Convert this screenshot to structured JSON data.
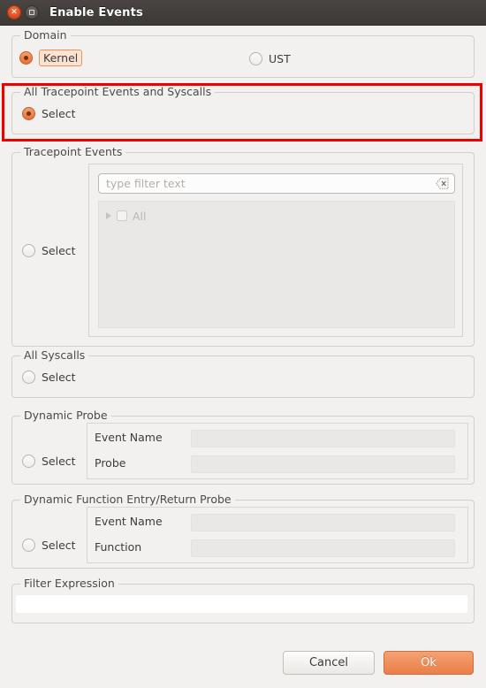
{
  "window": {
    "title": "Enable Events",
    "close_icon": "close-icon",
    "maximize_icon": "maximize-icon"
  },
  "colors": {
    "accent_orange": "#e8703a",
    "ok_button": "#ef8f5c",
    "highlight_red": "#ee0000",
    "window_bg": "#f2f1f0",
    "titlebar": "#3c3835"
  },
  "domain": {
    "legend": "Domain",
    "options": [
      {
        "label": "Kernel",
        "selected": true,
        "focused": true
      },
      {
        "label": "UST",
        "selected": false,
        "focused": false
      }
    ]
  },
  "all_tracepoints": {
    "legend": "All Tracepoint Events and Syscalls",
    "select_label": "Select",
    "selected": true,
    "highlighted": true
  },
  "tracepoint_events": {
    "legend": "Tracepoint Events",
    "select_label": "Select",
    "selected": false,
    "filter": {
      "placeholder": "type filter text",
      "value": "",
      "clear_icon": "clear-icon"
    },
    "tree": [
      {
        "label": "All",
        "checked": false,
        "expanded": false,
        "disabled": true,
        "expander_icon": "chevron-right-icon"
      }
    ]
  },
  "all_syscalls": {
    "legend": "All Syscalls",
    "select_label": "Select",
    "selected": false
  },
  "dynamic_probe": {
    "legend": "Dynamic Probe",
    "select_label": "Select",
    "selected": false,
    "fields": [
      {
        "label": "Event Name",
        "value": "",
        "disabled": true
      },
      {
        "label": "Probe",
        "value": "",
        "disabled": true
      }
    ]
  },
  "dynamic_function_probe": {
    "legend": "Dynamic Function Entry/Return Probe",
    "select_label": "Select",
    "selected": false,
    "fields": [
      {
        "label": "Event Name",
        "value": "",
        "disabled": true
      },
      {
        "label": "Function",
        "value": "",
        "disabled": true
      }
    ]
  },
  "filter_expression": {
    "legend": "Filter Expression",
    "value": "",
    "placeholder": ""
  },
  "buttons": {
    "cancel": "Cancel",
    "ok": "Ok"
  }
}
